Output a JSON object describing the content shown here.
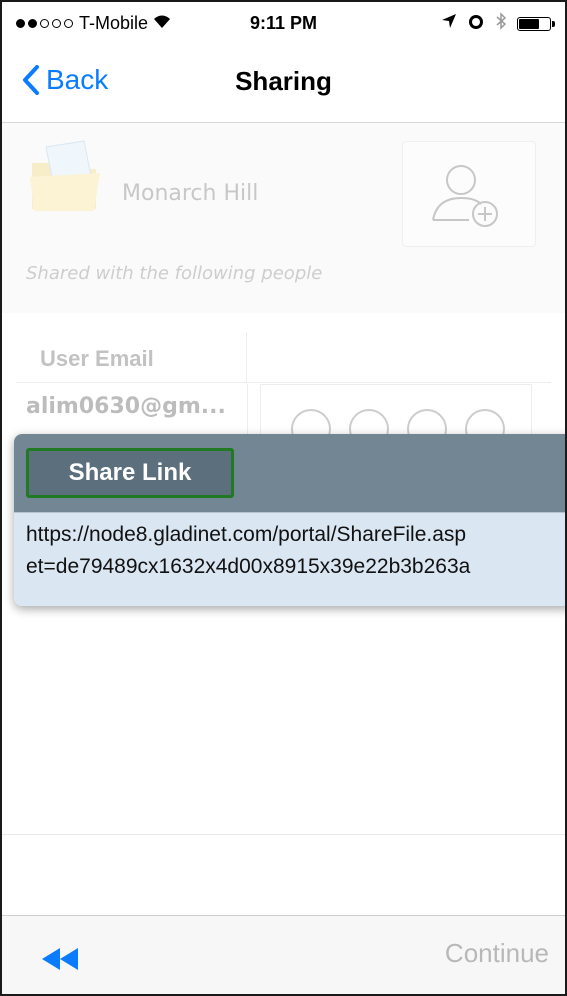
{
  "status_bar": {
    "carrier": "T-Mobile",
    "time": "9:11 PM",
    "signal_dots_filled": 2,
    "signal_dots_total": 5,
    "battery_level": 0.7
  },
  "nav": {
    "back_label": "Back",
    "title": "Sharing"
  },
  "folder": {
    "name": "Monarch Hill",
    "shared_note": "Shared with the following people"
  },
  "table": {
    "header_email": "User Email",
    "rows": [
      {
        "email": "alim0630@gm..."
      }
    ]
  },
  "share_link": {
    "button_label": "Share Link",
    "url_line1": "https://node8.gladinet.com/portal/ShareFile.asp",
    "url_line2": "et=de79489cx1632x4d00x8915x39e22b3b263a"
  },
  "toolbar": {
    "continue_label": "Continue"
  },
  "colors": {
    "accent": "#0a7cff",
    "popup_header": "#738694",
    "popup_body": "#dbe6f3",
    "share_button_border": "#1f7a23"
  }
}
